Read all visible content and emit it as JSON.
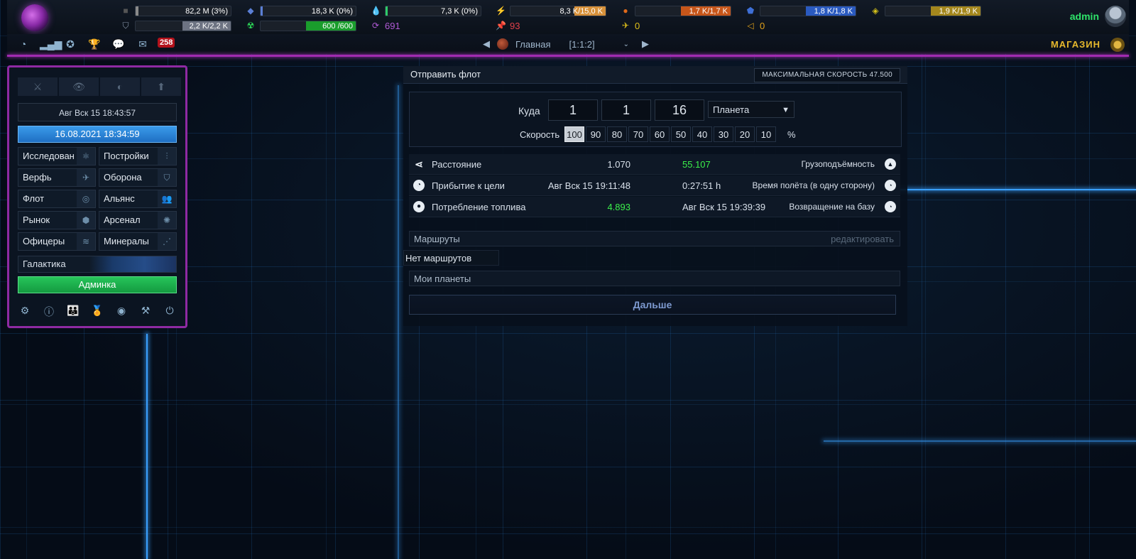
{
  "topbar": {
    "metal": "82,2 M (3%)",
    "crystal": "18,3 K (0%)",
    "deuterium": "7,3 K (0%)",
    "energy_a": "8,3 K/",
    "energy_b": "15,0 K",
    "res5_a": "1,7 K/",
    "res5_b": "1,7 K",
    "res6_a": "1,8 K/",
    "res6_b": "1,8 K",
    "res7_a": "1,9 K/",
    "res7_b": "1,9 K",
    "shield_a": "2,2 K/",
    "shield_b": "2,2 K",
    "radiation_a": "600 ",
    "radiation_b": "/600",
    "cycle": "691",
    "pin": "93",
    "fighter": "0",
    "horn": "0",
    "user": "admin"
  },
  "nav": {
    "messages_badge": "258",
    "planet_name": "Главная",
    "planet_coords": "[1:1:2]",
    "shop": "МАГАЗИН"
  },
  "left": {
    "server_time": "Авг Вск 15 18:43:57",
    "local_time": "16.08.2021 18:34:59",
    "buttons": [
      "Исследован",
      "Постройки",
      "Верфь",
      "Оборона",
      "Флот",
      "Альянс",
      "Рынок",
      "Арсенал",
      "Офицеры",
      "Минералы"
    ],
    "galaxy": "Галактика",
    "admin": "Админка"
  },
  "fleet": {
    "title": "Отправить флот",
    "max_speed": "МАКСИМАЛЬНАЯ СКОРОСТЬ 47.500",
    "target_label": "Куда",
    "galaxy": "1",
    "system": "1",
    "planet": "16",
    "target_type": "Планета",
    "speed_label": "Скорость",
    "speeds": [
      "100",
      "90",
      "80",
      "70",
      "60",
      "50",
      "40",
      "30",
      "20",
      "10"
    ],
    "percent": "%",
    "distance_label": "Расстояние",
    "distance": "1.070",
    "capacity": "55.107",
    "capacity_label": "Грузоподъёмность",
    "arrival_label": "Прибытие к цели",
    "arrival_time": "Авг Вск 15 19:11:48",
    "duration": "0:27:51 h",
    "duration_label": "Время полёта (в одну сторону)",
    "fuel_label": "Потребление топлива",
    "fuel": "4.893",
    "return_time": "Авг Вск 15 19:39:39",
    "return_label": "Возвращение на базу",
    "routes": "Маршруты",
    "routes_edit": "редактировать",
    "no_routes": "Нет маршрутов",
    "my_planets": "Мои планеты",
    "next": "Дальше"
  }
}
